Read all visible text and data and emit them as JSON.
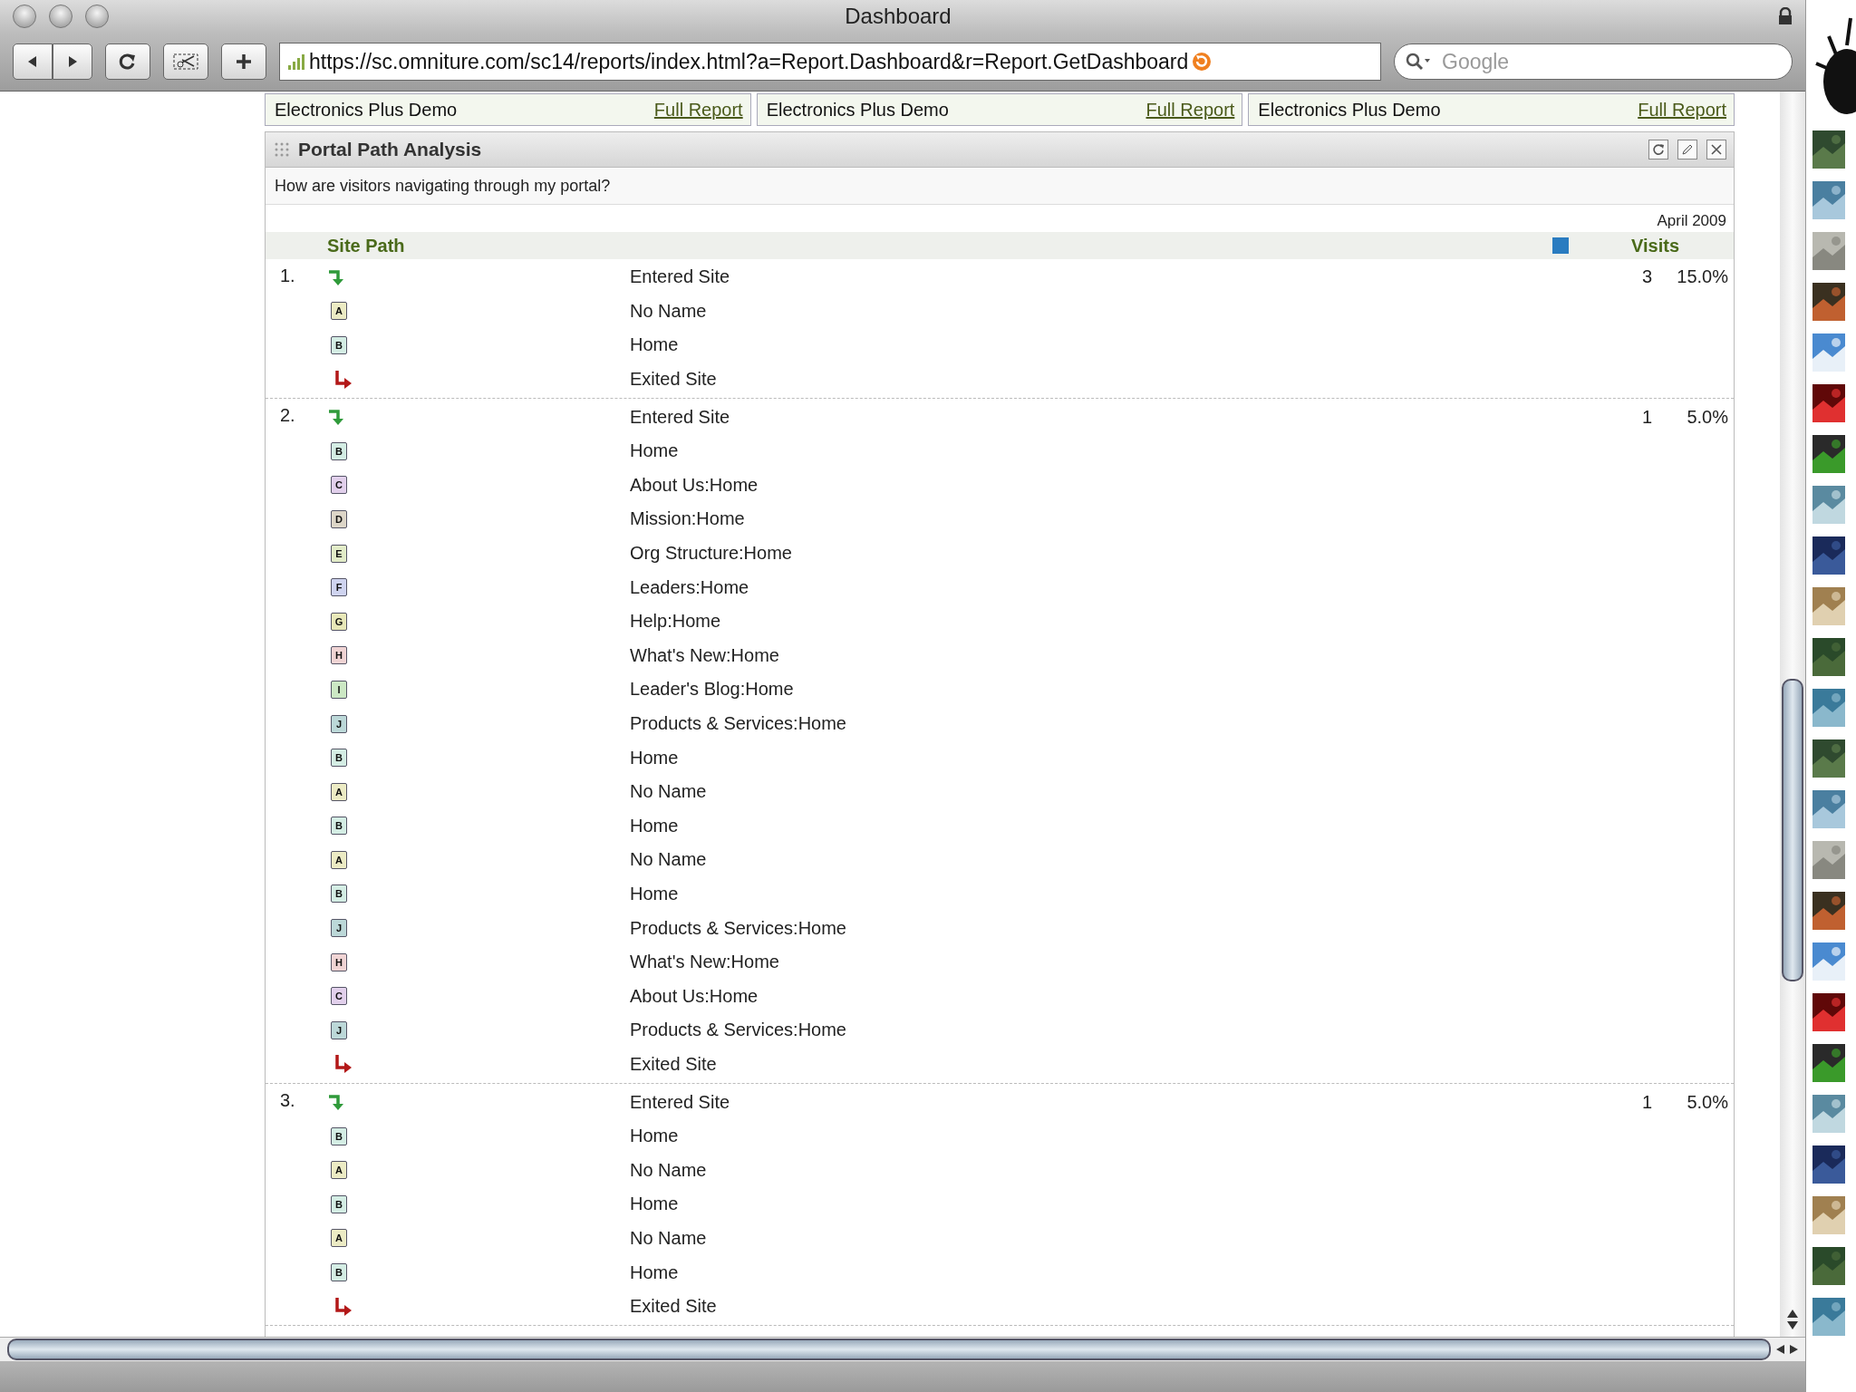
{
  "window": {
    "title": "Dashboard"
  },
  "toolbar": {
    "url": "https://sc.omniture.com/sc14/reports/index.html?a=Report.Dashboard&r=Report.GetDashboard",
    "search": {
      "placeholder": "Google"
    }
  },
  "report_links": [
    {
      "title": "Electronics Plus Demo",
      "link": "Full Report"
    },
    {
      "title": "Electronics Plus Demo",
      "link": "Full Report"
    },
    {
      "title": "Electronics Plus Demo",
      "link": "Full Report"
    }
  ],
  "panel": {
    "title": "Portal Path Analysis",
    "question": "How are visitors navigating through my portal?",
    "period": "April 2009",
    "columns": [
      "Site Path",
      "Visits"
    ],
    "paths": [
      {
        "rank": "1.",
        "visits": "3",
        "share": "15.0%",
        "steps": [
          {
            "kind": "entry",
            "label": "Entered Site"
          },
          {
            "kind": "page",
            "letter": "A",
            "color": "#ecebc4",
            "label": "No Name"
          },
          {
            "kind": "page",
            "letter": "B",
            "color": "#d4ede4",
            "label": "Home"
          },
          {
            "kind": "exit",
            "label": "Exited Site"
          }
        ]
      },
      {
        "rank": "2.",
        "visits": "1",
        "share": "5.0%",
        "steps": [
          {
            "kind": "entry",
            "label": "Entered Site"
          },
          {
            "kind": "page",
            "letter": "B",
            "color": "#d4ede4",
            "label": "Home"
          },
          {
            "kind": "page",
            "letter": "C",
            "color": "#e2d0ec",
            "label": "About Us:Home"
          },
          {
            "kind": "page",
            "letter": "D",
            "color": "#ddd6c8",
            "label": "Mission:Home"
          },
          {
            "kind": "page",
            "letter": "E",
            "color": "#e2ecc8",
            "label": "Org Structure:Home"
          },
          {
            "kind": "page",
            "letter": "F",
            "color": "#cfd4f0",
            "label": "Leaders:Home"
          },
          {
            "kind": "page",
            "letter": "G",
            "color": "#e8e8b8",
            "label": "Help:Home"
          },
          {
            "kind": "page",
            "letter": "H",
            "color": "#f0d4d4",
            "label": "What's New:Home"
          },
          {
            "kind": "page",
            "letter": "I",
            "color": "#cce8c4",
            "label": "Leader's Blog:Home"
          },
          {
            "kind": "page",
            "letter": "J",
            "color": "#bcd8d8",
            "label": "Products & Services:Home"
          },
          {
            "kind": "page",
            "letter": "B",
            "color": "#d4ede4",
            "label": "Home"
          },
          {
            "kind": "page",
            "letter": "A",
            "color": "#ecebc4",
            "label": "No Name"
          },
          {
            "kind": "page",
            "letter": "B",
            "color": "#d4ede4",
            "label": "Home"
          },
          {
            "kind": "page",
            "letter": "A",
            "color": "#ecebc4",
            "label": "No Name"
          },
          {
            "kind": "page",
            "letter": "B",
            "color": "#d4ede4",
            "label": "Home"
          },
          {
            "kind": "page",
            "letter": "J",
            "color": "#bcd8d8",
            "label": "Products & Services:Home"
          },
          {
            "kind": "page",
            "letter": "H",
            "color": "#f0d4d4",
            "label": "What's New:Home"
          },
          {
            "kind": "page",
            "letter": "C",
            "color": "#e2d0ec",
            "label": "About Us:Home"
          },
          {
            "kind": "page",
            "letter": "J",
            "color": "#bcd8d8",
            "label": "Products & Services:Home"
          },
          {
            "kind": "exit",
            "label": "Exited Site"
          }
        ]
      },
      {
        "rank": "3.",
        "visits": "1",
        "share": "5.0%",
        "steps": [
          {
            "kind": "entry",
            "label": "Entered Site"
          },
          {
            "kind": "page",
            "letter": "B",
            "color": "#d4ede4",
            "label": "Home"
          },
          {
            "kind": "page",
            "letter": "A",
            "color": "#ecebc4",
            "label": "No Name"
          },
          {
            "kind": "page",
            "letter": "B",
            "color": "#d4ede4",
            "label": "Home"
          },
          {
            "kind": "page",
            "letter": "A",
            "color": "#ecebc4",
            "label": "No Name"
          },
          {
            "kind": "page",
            "letter": "B",
            "color": "#d4ede4",
            "label": "Home"
          },
          {
            "kind": "exit",
            "label": "Exited Site"
          }
        ]
      }
    ]
  }
}
